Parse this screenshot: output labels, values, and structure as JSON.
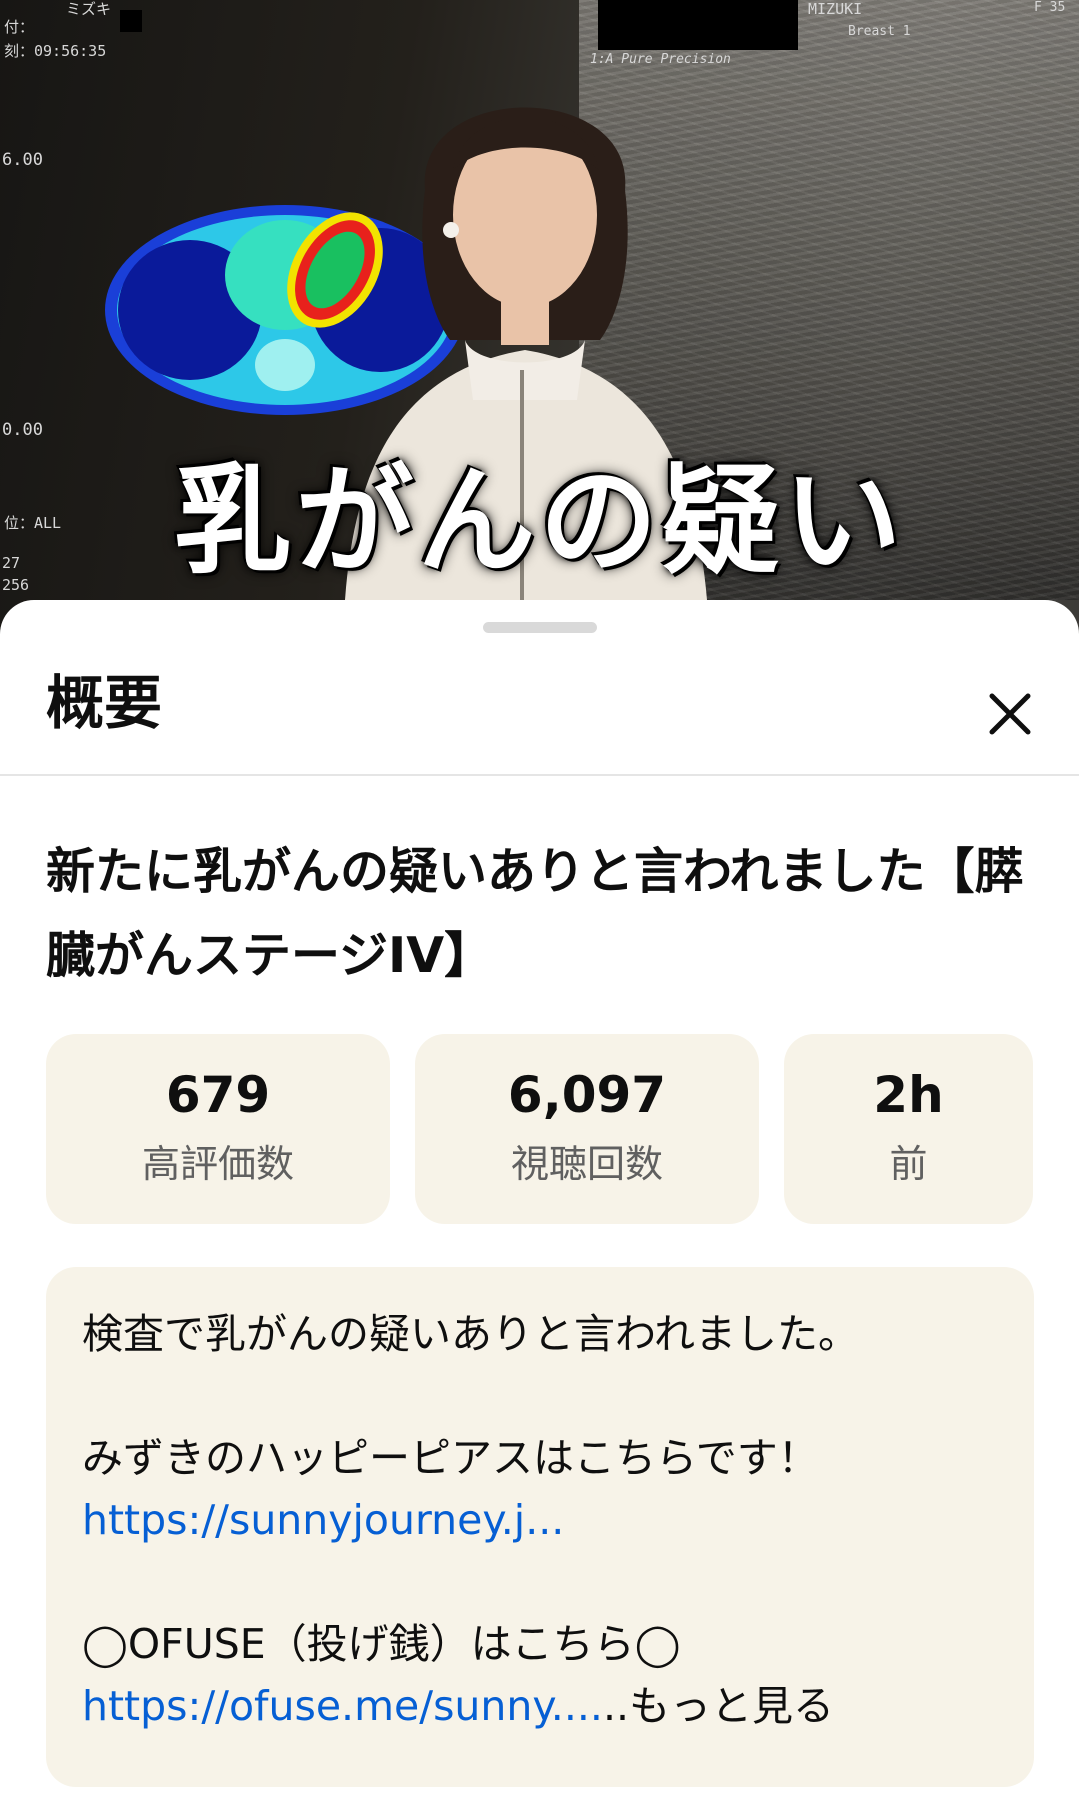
{
  "video": {
    "overlay_title": "乳がんの疑い",
    "hud_texts": {
      "date_label": "付：",
      "time_label": "刻：09:56:35",
      "value_top": "6.00",
      "value_mid": "0.00",
      "position": "位：ALL",
      "num_a": "27",
      "num_b": "256",
      "probe_brand": "1:A Pure Precision",
      "patient_name": "MIZUKI",
      "region": "Breast 1",
      "frame": "F 35",
      "katakana_name": "ミズキ"
    }
  },
  "sheet": {
    "title": "概要",
    "close_icon": "close-icon",
    "video_title": "新たに乳がんの疑いありと言われました【膵臓がんステージIV】",
    "stats": [
      {
        "value": "679",
        "label": "高評価数"
      },
      {
        "value": "6,097",
        "label": "視聴回数"
      },
      {
        "value": "2h",
        "label": "前"
      }
    ],
    "description": {
      "line1": "検査で乳がんの疑いありと言われました。",
      "line2": "みずきのハッピーピアスはこちらです！",
      "link1": "https://sunnyjourney.j...",
      "line3": "◯OFUSE（投げ銭）はこちら◯",
      "link2": "https://ofuse.me/sunny....",
      "more_label": "..もっと見る"
    }
  },
  "colors": {
    "stat_bg": "#f7f3e8",
    "link": "#065fd4",
    "handle": "#d9d9d9"
  }
}
